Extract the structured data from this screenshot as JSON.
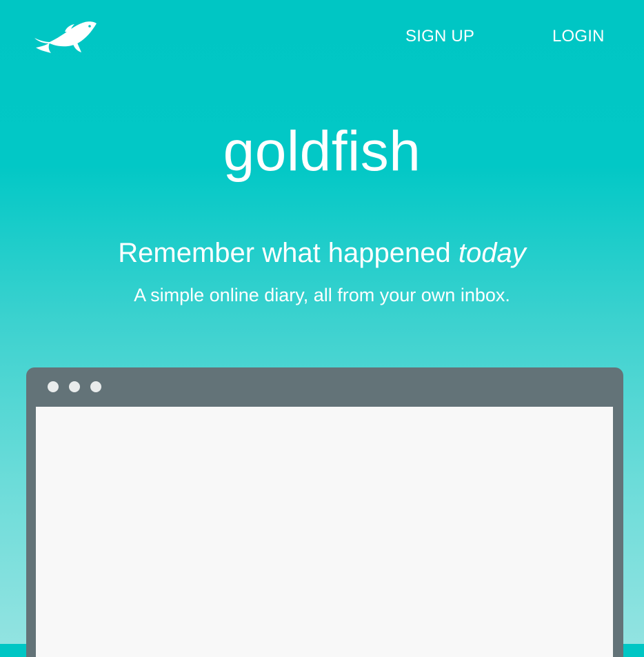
{
  "nav": {
    "logo_icon": "goldfish-logo-icon",
    "signup_label": "SIGN UP",
    "login_label": "LOGIN"
  },
  "hero": {
    "title": "goldfish",
    "tagline_main": "Remember what happened ",
    "tagline_emphasis": "today",
    "subtagline": "A simple online diary, all from your own inbox."
  },
  "browser_mockup": {
    "dots": [
      "window-dot",
      "window-dot",
      "window-dot"
    ]
  },
  "colors": {
    "background_top": "#00c6c4",
    "background_bottom": "#92e3e1",
    "text": "#ffffff",
    "browser_frame": "#637378",
    "browser_viewport": "#f8f8f8",
    "browser_dots": "#e9ecec"
  }
}
